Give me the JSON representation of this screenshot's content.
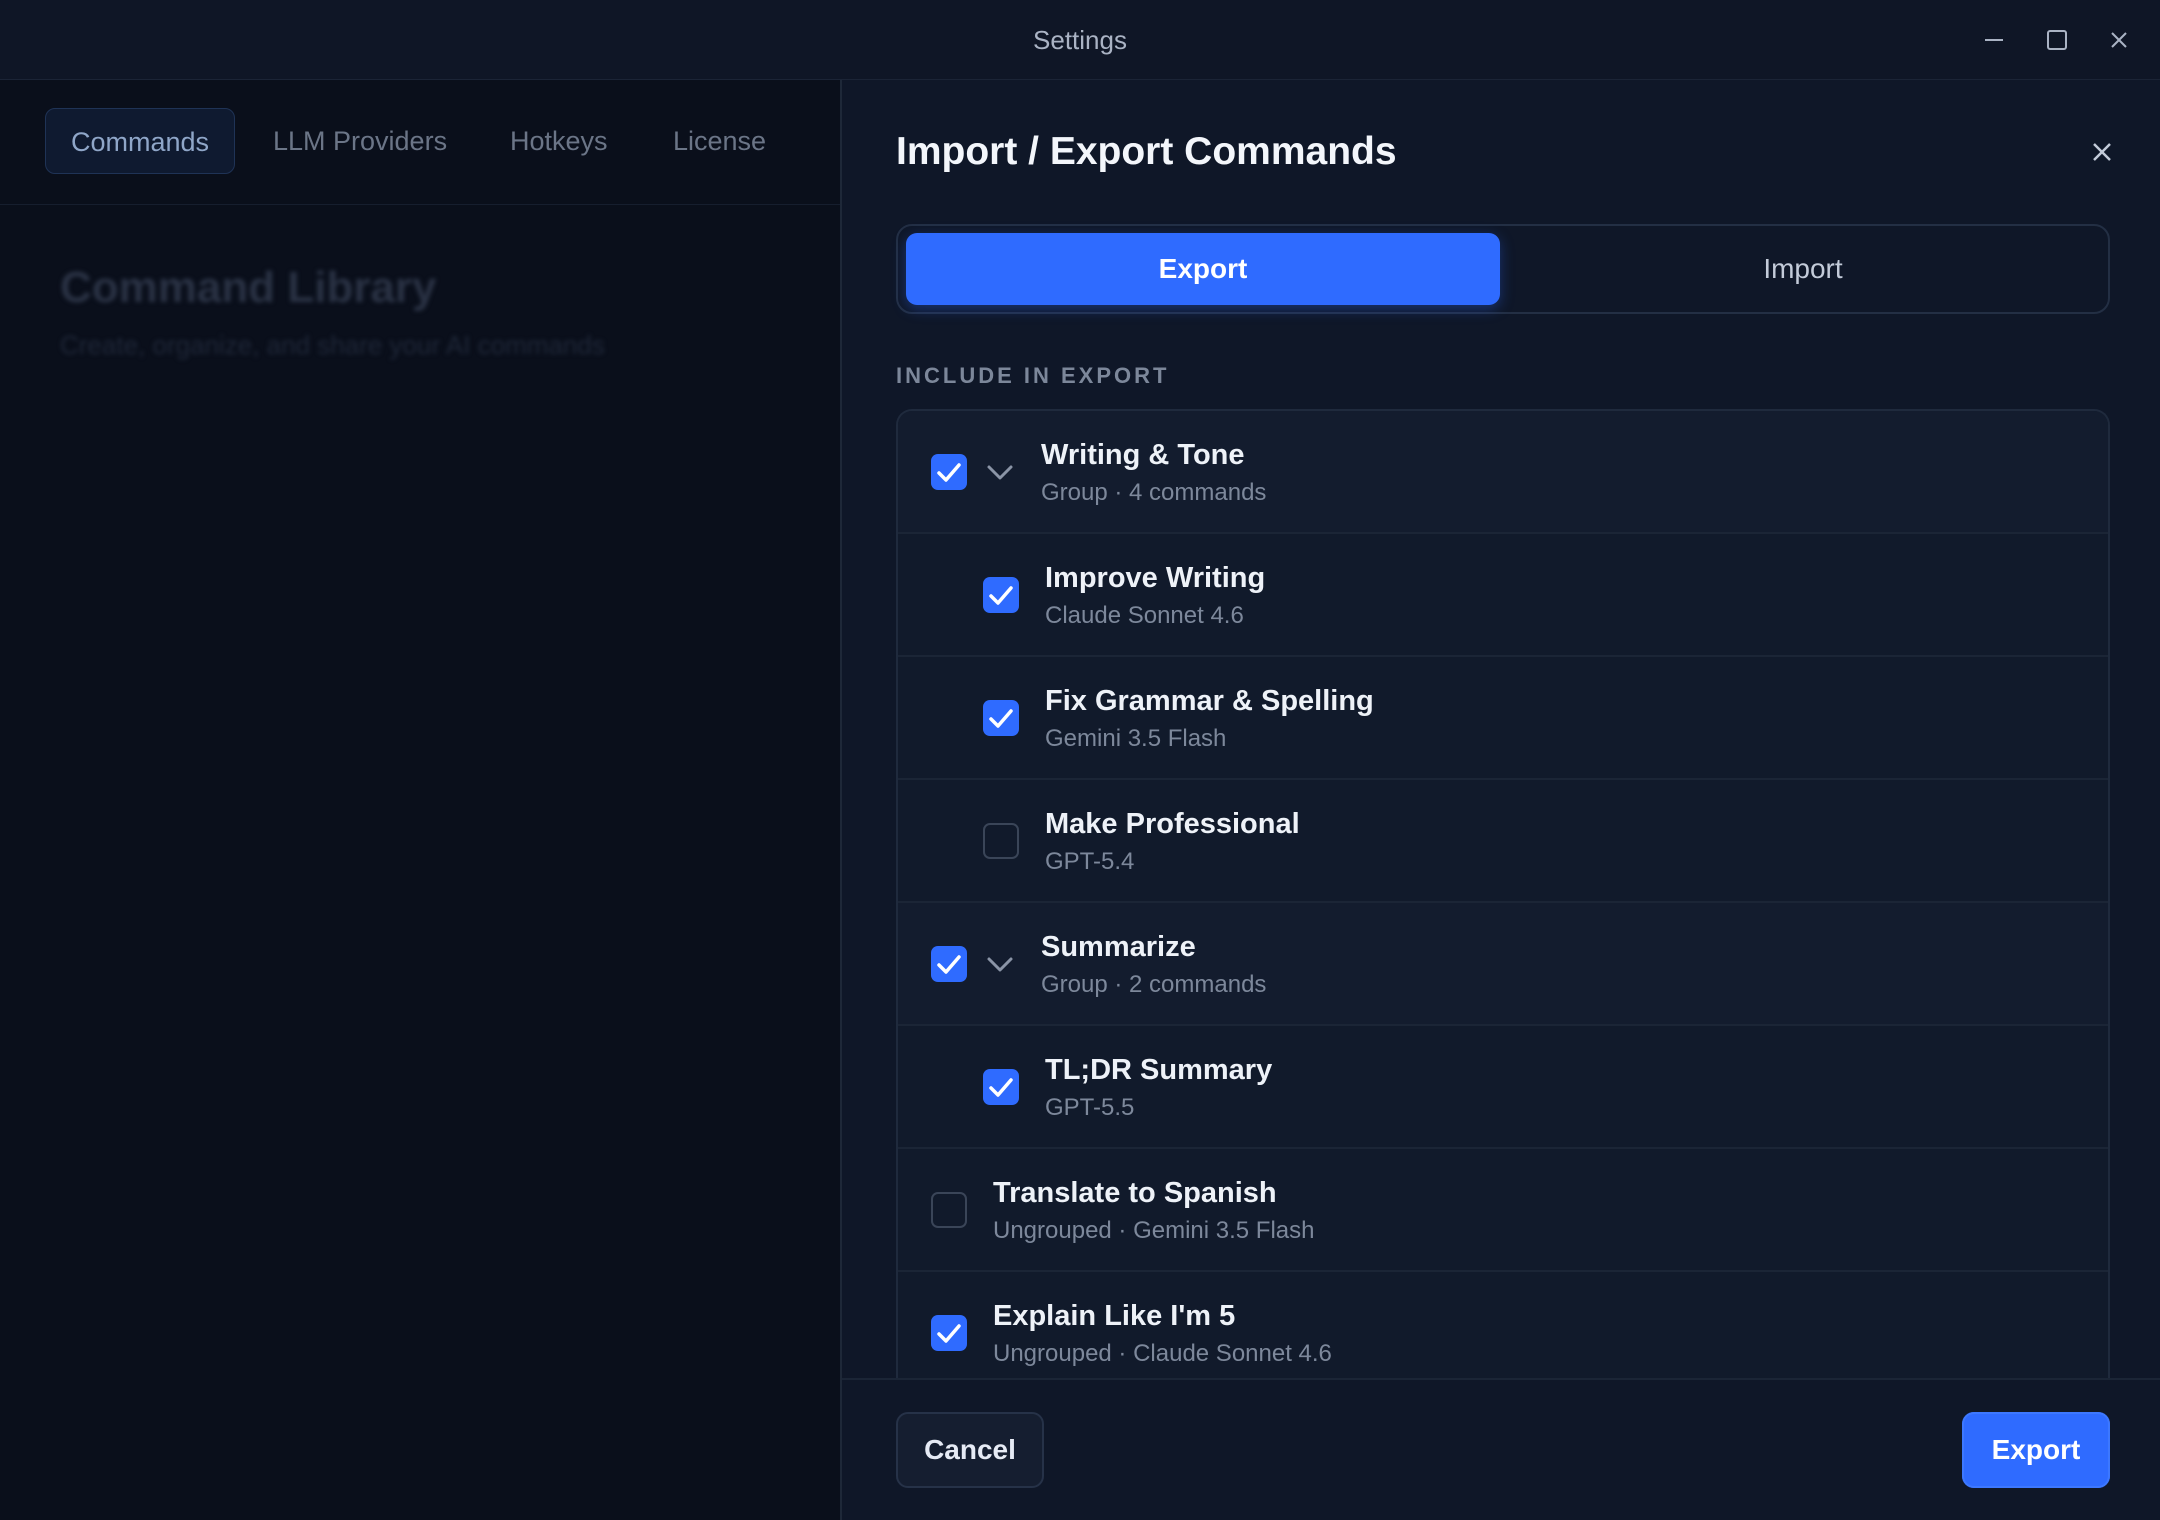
{
  "window": {
    "title": "Settings"
  },
  "settings_tabs": [
    {
      "label": "Commands",
      "active": true
    },
    {
      "label": "LLM Providers",
      "active": false
    },
    {
      "label": "Hotkeys",
      "active": false
    },
    {
      "label": "License",
      "active": false
    }
  ],
  "library": {
    "title": "Command Library",
    "subtitle": "Create, organize, and share your AI commands"
  },
  "dialog": {
    "title": "Import / Export Commands",
    "segment": {
      "export_label": "Export",
      "import_label": "Import",
      "selected": "Export"
    },
    "section_label": "INCLUDE IN EXPORT",
    "items": [
      {
        "type": "group",
        "name": "Writing & Tone",
        "sub": "Group · 4 commands",
        "checked": true,
        "expanded": true
      },
      {
        "type": "child",
        "name": "Improve Writing",
        "sub": "Claude Sonnet 4.6",
        "checked": true
      },
      {
        "type": "child",
        "name": "Fix Grammar & Spelling",
        "sub": "Gemini 3.5 Flash",
        "checked": true
      },
      {
        "type": "child",
        "name": "Make Professional",
        "sub": "GPT-5.4",
        "checked": false
      },
      {
        "type": "group",
        "name": "Summarize",
        "sub": "Group · 2 commands",
        "checked": true,
        "expanded": true
      },
      {
        "type": "child",
        "name": "TL;DR Summary",
        "sub": "GPT-5.5",
        "checked": true
      },
      {
        "type": "ungrouped",
        "name": "Translate to Spanish",
        "sub": "Ungrouped · Gemini 3.5 Flash",
        "checked": false
      },
      {
        "type": "ungrouped",
        "name": "Explain Like I'm 5",
        "sub": "Ungrouped · Claude Sonnet 4.6",
        "checked": true
      }
    ],
    "cancel_label": "Cancel",
    "export_label": "Export"
  },
  "colors": {
    "accent": "#2f6bff",
    "background": "#0f1728"
  }
}
